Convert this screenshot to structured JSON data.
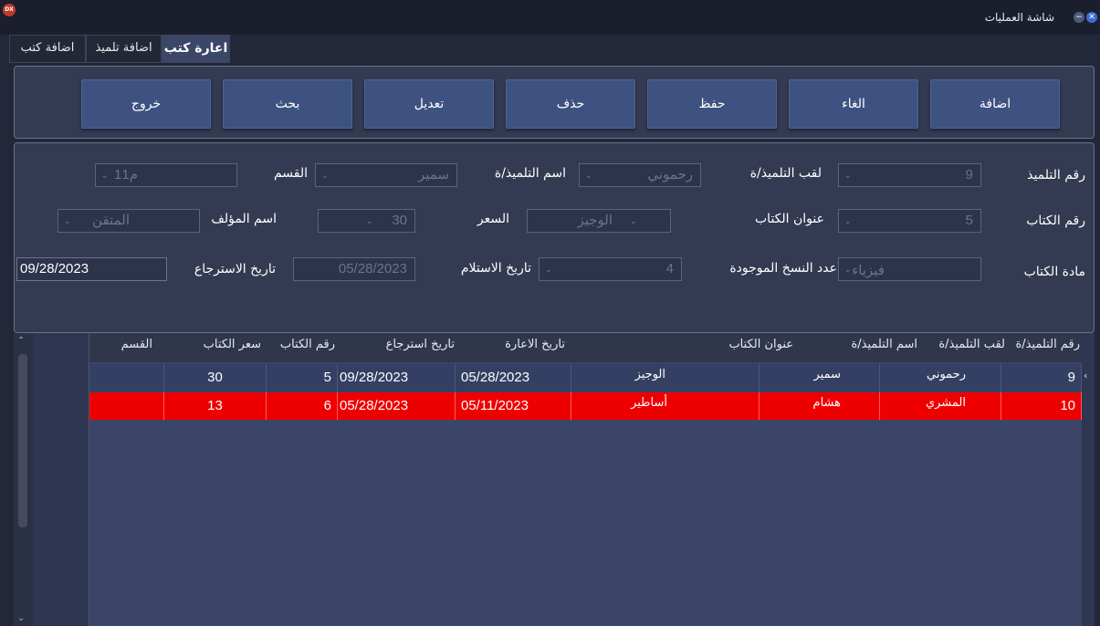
{
  "window": {
    "title": "شاشة العمليات",
    "app_logo_text": "DX"
  },
  "tabs": [
    {
      "label": "اعارة كتب",
      "active": true
    },
    {
      "label": "اضافة تلميذ",
      "active": false
    },
    {
      "label": "اضافة كتب",
      "active": false
    }
  ],
  "toolbar": {
    "add": "اضافة",
    "cancel": "الغاء",
    "save": "حفظ",
    "delete": "حذف",
    "edit": "تعديل",
    "search": "بحث",
    "exit": "خروج"
  },
  "form": {
    "student_id": {
      "label": "رقم التلميذ",
      "value": "9"
    },
    "student_surname": {
      "label": "لقب التلميذ/ة",
      "value": "رحموني"
    },
    "student_name": {
      "label": "اسم التلميذ/ة",
      "value": "سمير"
    },
    "section": {
      "label": "القسم",
      "value": "1م1"
    },
    "book_id": {
      "label": "رقم الكتاب",
      "value": "5"
    },
    "book_title": {
      "label": "عنوان الكتاب",
      "value": "الوجيز"
    },
    "price": {
      "label": "السعر",
      "value": "30"
    },
    "author": {
      "label": "اسم المؤلف",
      "value": "المتقن"
    },
    "subject": {
      "label": "مادة الكتاب",
      "value": "فيزياء"
    },
    "copies": {
      "label": "عدد النسخ الموجودة",
      "value": "4"
    },
    "receive_date": {
      "label": "تاريخ الاستلام",
      "value": "05/28/2023"
    },
    "return_date": {
      "label": "تاريخ الاسترجاع",
      "value": "09/28/2023"
    }
  },
  "table": {
    "columns": [
      "رقم التلميذ/ة",
      "لقب التلميذ/ة",
      "اسم التلميذ/ة",
      "عنوان الكتاب",
      "تاريخ الاعارة",
      "تاريخ استرجاع",
      "رقم الكتاب",
      "سعر الكتاب",
      "القسم"
    ],
    "rows": [
      {
        "student_id": "9",
        "surname": "رحموني",
        "name": "سمير",
        "title": "الوجيز",
        "loan_date": "05/28/2023",
        "return_date": "09/28/2023",
        "book_id": "5",
        "price": "30",
        "section": ""
      },
      {
        "student_id": "10",
        "surname": "المشري",
        "name": "هشام",
        "title": "أساطير",
        "loan_date": "05/11/2023",
        "return_date": "05/28/2023",
        "book_id": "6",
        "price": "13",
        "section": ""
      }
    ]
  },
  "colors": {
    "background": "#22283a",
    "button": "#3e5281",
    "panel": "#333a52",
    "overdue_row": "#ee0000",
    "grid_row": "#334063"
  },
  "icons": {
    "close": "close-icon",
    "minimize": "minimize-icon",
    "row_pointer": "row-pointer-icon",
    "dropdown": "chevron-down-icon",
    "scroll_up": "scroll-up-icon",
    "scroll_down": "scroll-down-icon"
  }
}
